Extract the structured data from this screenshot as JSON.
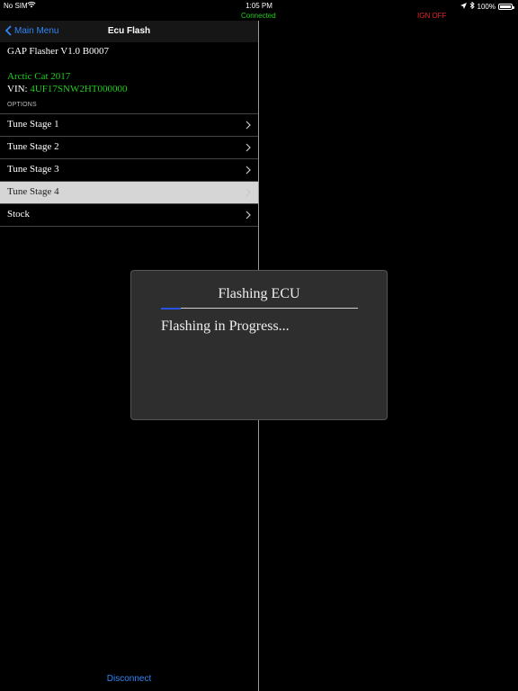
{
  "status_bar": {
    "carrier": "No SIM",
    "time": "1:05 PM",
    "battery": "100%"
  },
  "connection": {
    "connected_label": "Connected",
    "ignition_label": "IGN OFF",
    "colors": {
      "connected": "#1fce1f",
      "ignition": "#e32626"
    }
  },
  "nav": {
    "back_label": "Main Menu",
    "title": "Ecu Flash"
  },
  "device": {
    "name": "GAP Flasher V1.0 B0007",
    "vehicle": "Arctic Cat 2017",
    "vin_label": "VIN:",
    "vin_value": "4UF17SNW2HT000000"
  },
  "options": {
    "header": "OPTIONS",
    "items": [
      {
        "label": "Tune Stage 1"
      },
      {
        "label": "Tune Stage 2"
      },
      {
        "label": "Tune Stage 3"
      },
      {
        "label": "Tune Stage 4"
      },
      {
        "label": "Stock"
      }
    ],
    "selected_index": 3
  },
  "footer": {
    "disconnect_label": "Disconnect"
  },
  "dialog": {
    "title": "Flashing ECU",
    "message": "Flashing in Progress...",
    "progress": 0.1
  },
  "colors": {
    "accent": "#2f86f6",
    "highlight": "#1fce1f",
    "progress": "#2851e6"
  }
}
